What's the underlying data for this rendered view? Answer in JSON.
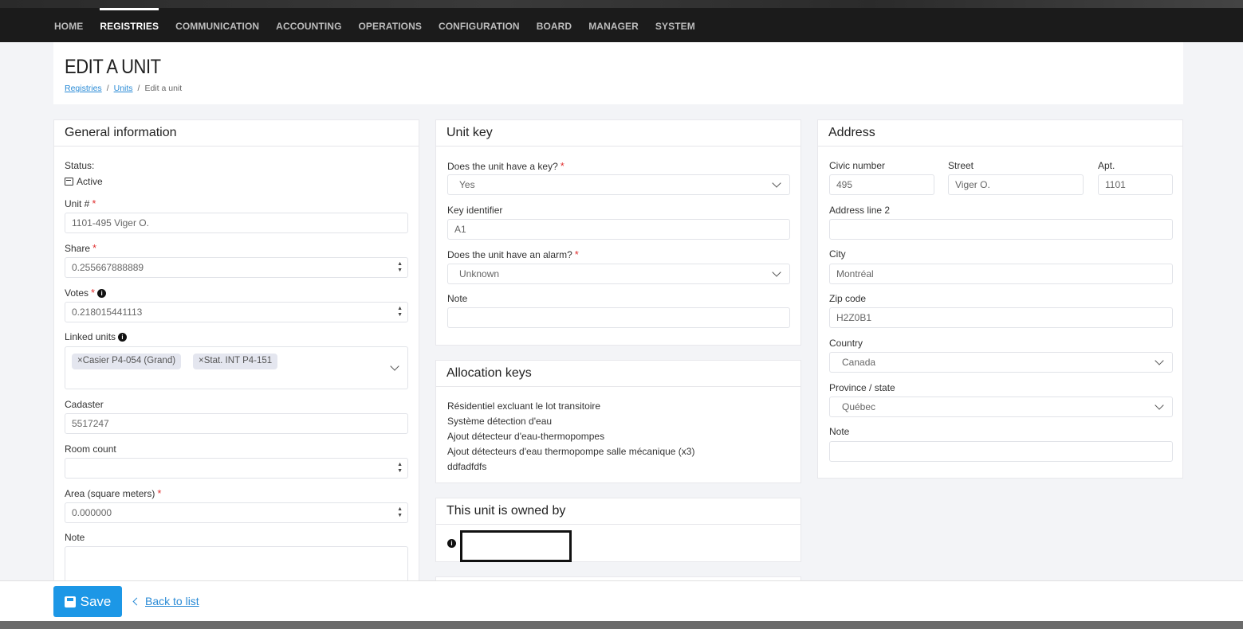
{
  "nav": {
    "items": [
      "HOME",
      "REGISTRIES",
      "COMMUNICATION",
      "ACCOUNTING",
      "OPERATIONS",
      "CONFIGURATION",
      "BOARD",
      "MANAGER",
      "SYSTEM"
    ],
    "active": "REGISTRIES"
  },
  "header": {
    "title": "EDIT A UNIT",
    "breadcrumb": [
      "Registries",
      "Units",
      "Edit a unit"
    ],
    "separator": "/"
  },
  "general": {
    "title": "General information",
    "status_label": "Status:",
    "status_value": "Active",
    "unit_label": "Unit #",
    "unit_value": "1101-495 Viger O.",
    "share_label": "Share",
    "share_value": "0.255667888889",
    "votes_label": "Votes",
    "votes_value": "0.218015441113",
    "linked_label": "Linked units",
    "linked_tags": [
      "×Casier P4-054 (Grand)",
      "×Stat. INT P4-151"
    ],
    "cadaster_label": "Cadaster",
    "cadaster_value": "5517247",
    "room_label": "Room count",
    "room_value": "",
    "area_label": "Area (square meters)",
    "area_value": "0.000000",
    "note_label": "Note"
  },
  "unit_key": {
    "title": "Unit key",
    "has_key_label": "Does the unit have a key?",
    "has_key_value": "Yes",
    "key_id_label": "Key identifier",
    "key_id_value": "A1",
    "alarm_label": "Does the unit have an alarm?",
    "alarm_value": "Unknown",
    "note_label": "Note"
  },
  "allocation": {
    "title": "Allocation keys",
    "items": [
      "Résidentiel excluant le lot transitoire",
      "Système détection d'eau",
      "Ajout détecteur d'eau-thermopompes",
      "Ajout détecteurs d'eau thermopompe salle mécanique (x3)",
      "ddfadfdfs"
    ]
  },
  "owned": {
    "title": "This unit is owned by"
  },
  "address": {
    "title": "Address",
    "civic_label": "Civic number",
    "civic_value": "495",
    "street_label": "Street",
    "street_value": "Viger O.",
    "apt_label": "Apt.",
    "apt_value": "1101",
    "line2_label": "Address line 2",
    "line2_value": "",
    "city_label": "City",
    "city_value": "Montréal",
    "zip_label": "Zip code",
    "zip_value": "H2Z0B1",
    "country_label": "Country",
    "country_value": "Canada",
    "province_label": "Province / state",
    "province_value": "Québec",
    "note_label": "Note"
  },
  "footer": {
    "save_label": "Save",
    "back_label": "Back to list"
  }
}
